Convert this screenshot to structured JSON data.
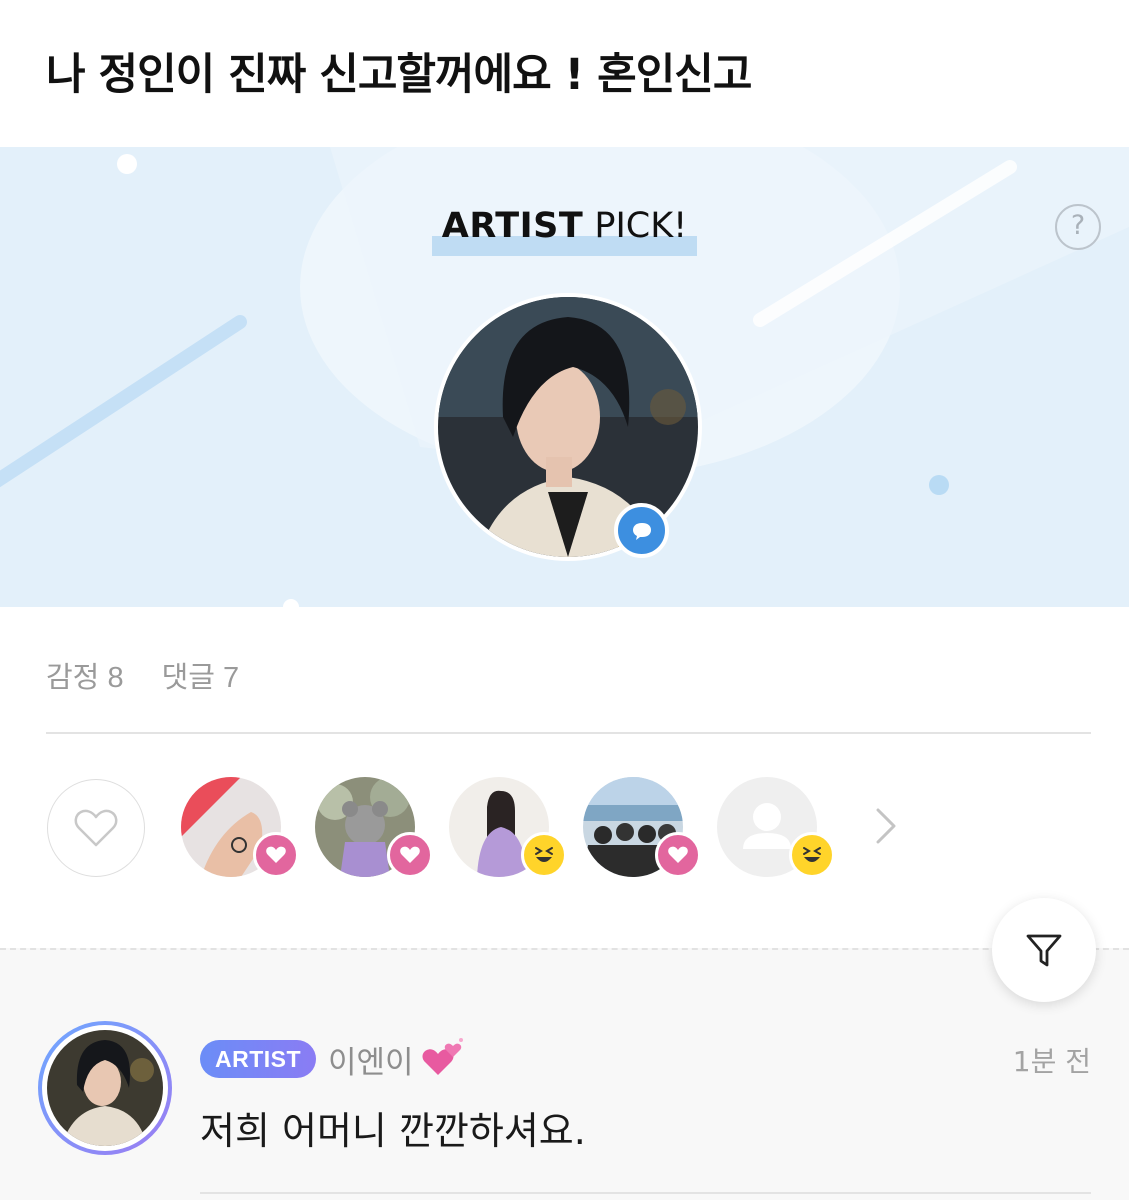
{
  "post": {
    "title": "나 정인이 진짜 신고할꺼에요 ! 혼인신고"
  },
  "artist_pick": {
    "heading_bold": "ARTIST",
    "heading_rest": " PICK!",
    "help_label": "?",
    "help_icon": "question-circle-icon",
    "badge_icon": "chat-bubble-icon",
    "bg_color": "#e3f0fa",
    "accent_color": "#3d8fe0"
  },
  "stats": {
    "emotion_label": "감정",
    "emotion_count": "8",
    "comment_label": "댓글",
    "comment_count": "7"
  },
  "reactions": {
    "like_icon": "heart-outline-icon",
    "users": [
      {
        "badge": "heart"
      },
      {
        "badge": "heart"
      },
      {
        "badge": "laugh"
      },
      {
        "badge": "heart"
      },
      {
        "badge": "laugh"
      }
    ],
    "more_icon": "chevron-right-icon",
    "heart_color": "#e2669e",
    "laugh_color": "#ffd42a"
  },
  "filter": {
    "icon": "filter-icon"
  },
  "comment": {
    "badge": "ARTIST",
    "author": "이엔이",
    "author_emoji": "sparkling-hearts-icon",
    "time": "1분 전",
    "text": "저희 어머니 깐깐하셔요."
  }
}
